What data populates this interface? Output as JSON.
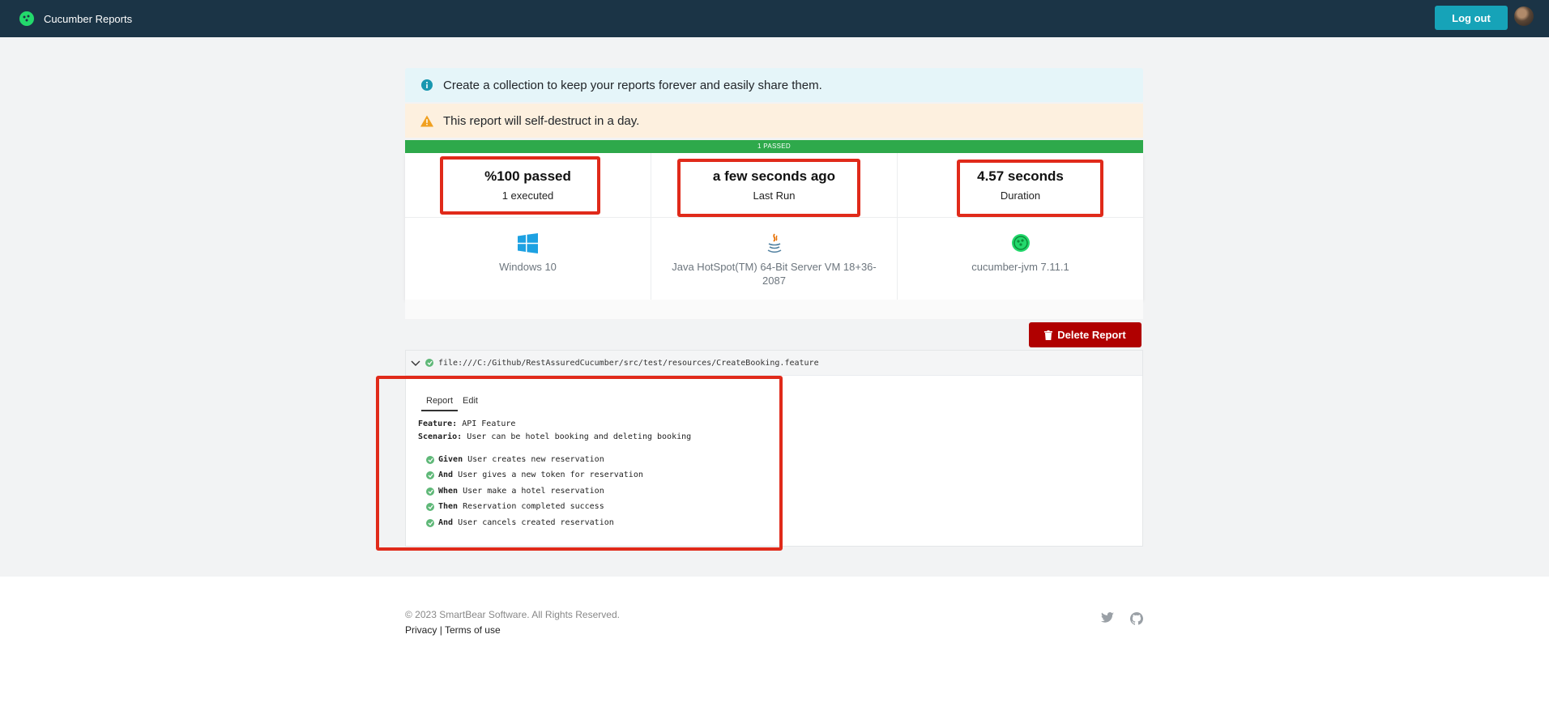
{
  "header": {
    "app_name": "Cucumber Reports",
    "logout_label": "Log out"
  },
  "alerts": {
    "info": "Create a collection to keep your reports forever and easily share them.",
    "warning": "This report will self-destruct in a day."
  },
  "status_bar": {
    "label": "1 PASSED",
    "color": "#2ea94b"
  },
  "summary": {
    "passed": {
      "value": "%100 passed",
      "label": "1 executed"
    },
    "last_run": {
      "value": "a few seconds ago",
      "label": "Last Run"
    },
    "duration": {
      "value": "4.57 seconds",
      "label": "Duration"
    }
  },
  "environment": {
    "os": {
      "icon": "windows-icon",
      "text": "Windows 10"
    },
    "runtime": {
      "icon": "java-icon",
      "text": "Java HotSpot(TM) 64-Bit Server VM 18+36-2087"
    },
    "tool": {
      "icon": "cucumber-icon",
      "text": "cucumber-jvm 7.11.1"
    }
  },
  "actions": {
    "delete_label": "Delete Report"
  },
  "feature_file": {
    "path": "file:///C:/Github/RestAssuredCucumber/src/test/resources/CreateBooking.feature",
    "tabs": [
      "Report",
      "Edit"
    ],
    "feature_keyword": "Feature:",
    "feature_name": "API Feature",
    "scenario_keyword": "Scenario:",
    "scenario_name": "User can be hotel booking and deleting booking",
    "steps": [
      {
        "keyword": "Given",
        "text": "User creates new reservation"
      },
      {
        "keyword": "And",
        "text": "User gives a new token for reservation"
      },
      {
        "keyword": "When",
        "text": "User make a hotel reservation"
      },
      {
        "keyword": "Then",
        "text": "Reservation completed success"
      },
      {
        "keyword": "And",
        "text": "User cancels created reservation"
      }
    ]
  },
  "footer": {
    "copyright": "© 2023 SmartBear Software. All Rights Reserved.",
    "privacy": "Privacy",
    "separator": "|",
    "terms": "Terms of use"
  },
  "colors": {
    "accent": "#16a3b8",
    "danger": "#b00000",
    "navbar": "#1b3446",
    "highlight": "#e02a1a"
  }
}
